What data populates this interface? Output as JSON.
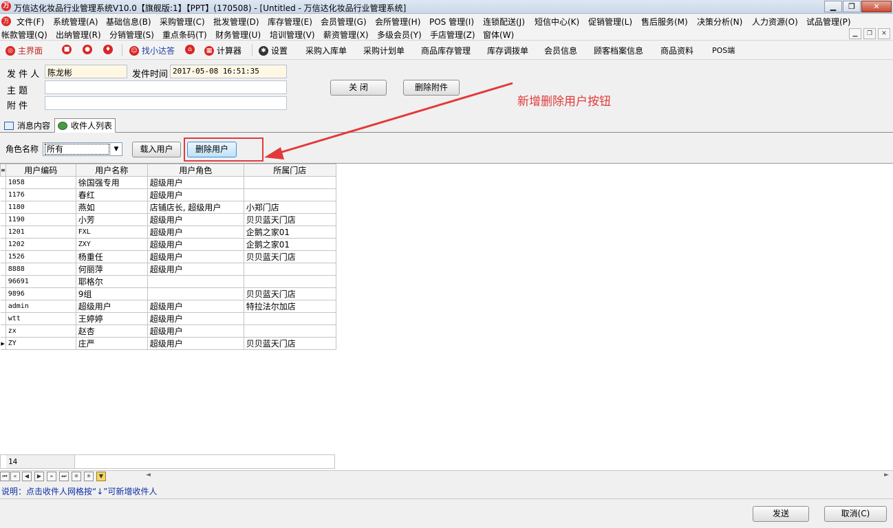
{
  "window": {
    "title": "万信达化妆品行业管理系统V10.0【旗舰版:1】【PPT】(170508) - [Untitled - 万信达化妆品行业管理系统]",
    "app_icon": "logo-icon"
  },
  "menu": {
    "row1": [
      "文件(F)",
      "系统管理(A)",
      "基础信息(B)",
      "采购管理(C)",
      "批发管理(D)",
      "库存管理(E)",
      "会员管理(G)",
      "会所管理(H)",
      "POS 管理(I)",
      "连锁配送(J)",
      "短信中心(K)",
      "促销管理(L)",
      "售后服务(M)",
      "决策分析(N)",
      "人力资源(O)",
      "试品管理(P)"
    ],
    "row2": [
      "帐款管理(Q)",
      "出纳管理(R)",
      "分销管理(S)",
      "重点条码(T)",
      "财务管理(U)",
      "培训管理(V)",
      "薪资管理(X)",
      "多级会员(Y)",
      "手店管理(Z)",
      "窗体(W)"
    ]
  },
  "toolbar": {
    "home": "主界面",
    "find": "找小达答",
    "calculator": "计算器",
    "settings": "设置",
    "links": [
      "采购入库单",
      "采购计划单",
      "商品库存管理",
      "库存调拨单",
      "会员信息",
      "顾客档案信息",
      "商品资料",
      "POS端"
    ]
  },
  "form": {
    "sender_label": "发 件 人",
    "sender_value": "陈龙彬",
    "time_label": "发件时间",
    "time_value": "2017-05-08 16:51:35",
    "subject_label": "主    题",
    "subject_value": "",
    "attach_label": "附    件",
    "attach_value": "",
    "close_button": "关  闭",
    "delete_attach_button": "删除附件"
  },
  "annotation": {
    "text": "新增删除用户按钮",
    "color": "#e23a3a"
  },
  "tabs": [
    "消息内容",
    "收件人列表"
  ],
  "filter": {
    "role_label": "角色名称",
    "role_value": "所有",
    "load_button": "载入用户",
    "delete_button": "删除用户"
  },
  "grid": {
    "columns": [
      "用户编码",
      "用户名称",
      "用户角色",
      "所属门店"
    ],
    "rows": [
      [
        "1058",
        "徐国强专用",
        "超级用户",
        ""
      ],
      [
        "1176",
        "春红",
        "超级用户",
        ""
      ],
      [
        "1180",
        "燕如",
        "店铺店长, 超级用户",
        "小郑门店"
      ],
      [
        "1190",
        "小芳",
        "超级用户",
        "贝贝蓝天门店"
      ],
      [
        "1201",
        "FXL",
        "超级用户",
        "企鹅之家01"
      ],
      [
        "1202",
        "ZXY",
        "超级用户",
        "企鹅之家01"
      ],
      [
        "1526",
        "杨重任",
        "超级用户",
        "贝贝蓝天门店"
      ],
      [
        "8888",
        "何丽萍",
        "超级用户",
        ""
      ],
      [
        "96691",
        "耶格尔",
        "",
        ""
      ],
      [
        "9896",
        "9组",
        "",
        "贝贝蓝天门店"
      ],
      [
        "admin",
        "超级用户",
        "超级用户",
        "特拉法尔加店"
      ],
      [
        "wtt",
        "王婷婷",
        "超级用户",
        ""
      ],
      [
        "zx",
        "赵杏",
        "超级用户",
        ""
      ],
      [
        "ZY",
        "庄严",
        "超级用户",
        "贝贝蓝天门店"
      ]
    ],
    "footer_count": "14"
  },
  "hint": "说明：点击收件人网格按“↓”可新增收件人",
  "actions": {
    "send": "发送",
    "cancel": "取消(C)"
  }
}
